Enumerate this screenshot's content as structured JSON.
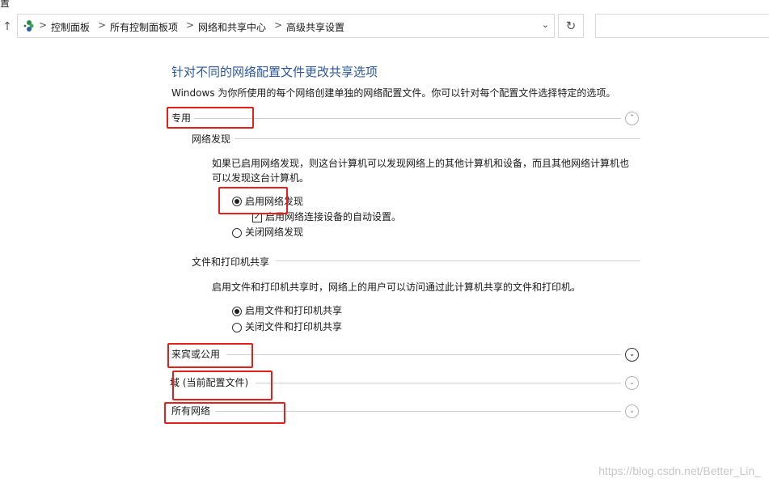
{
  "window": {
    "title_fragment": "置"
  },
  "address_bar": {
    "breadcrumbs": [
      "控制面板",
      "所有控制面板项",
      "网络和共享中心",
      "高级共享设置"
    ],
    "separator": ">",
    "dropdown_glyph": "⌄",
    "refresh_glyph": "↻",
    "up_glyph": "↑"
  },
  "page": {
    "title": "针对不同的网络配置文件更改共享选项",
    "description": "Windows 为你所使用的每个网络创建单独的网络配置文件。你可以针对每个配置文件选择特定的选项。"
  },
  "sections": {
    "private": {
      "label": "专用",
      "expanded": true,
      "network_discovery": {
        "heading": "网络发现",
        "description_line1": "如果已启用网络发现，则这台计算机可以发现网络上的其他计算机和设备，而且其他网络计算机也",
        "description_line2": "可以发现这台计算机。",
        "option_on": "启用网络发现",
        "option_on_selected": true,
        "auto_setup_label": "启用网络连接设备的自动设置。",
        "auto_setup_checked": true,
        "option_off": "关闭网络发现"
      },
      "file_printer_sharing": {
        "heading": "文件和打印机共享",
        "description": "启用文件和打印机共享时，网络上的用户可以访问通过此计算机共享的文件和打印机。",
        "option_on": "启用文件和打印机共享",
        "option_on_selected": true,
        "option_off": "关闭文件和打印机共享"
      }
    },
    "guest_public": {
      "label": "来宾或公用",
      "expanded": false
    },
    "domain": {
      "label": "域 (当前配置文件)",
      "expanded": false
    },
    "all_networks": {
      "label": "所有网络",
      "expanded": false
    }
  },
  "icons": {
    "collapse": "⌃",
    "expand": "⌄"
  },
  "annotation_color": "#e5201c",
  "watermark": "https://blog.csdn.net/Better_Lin_"
}
